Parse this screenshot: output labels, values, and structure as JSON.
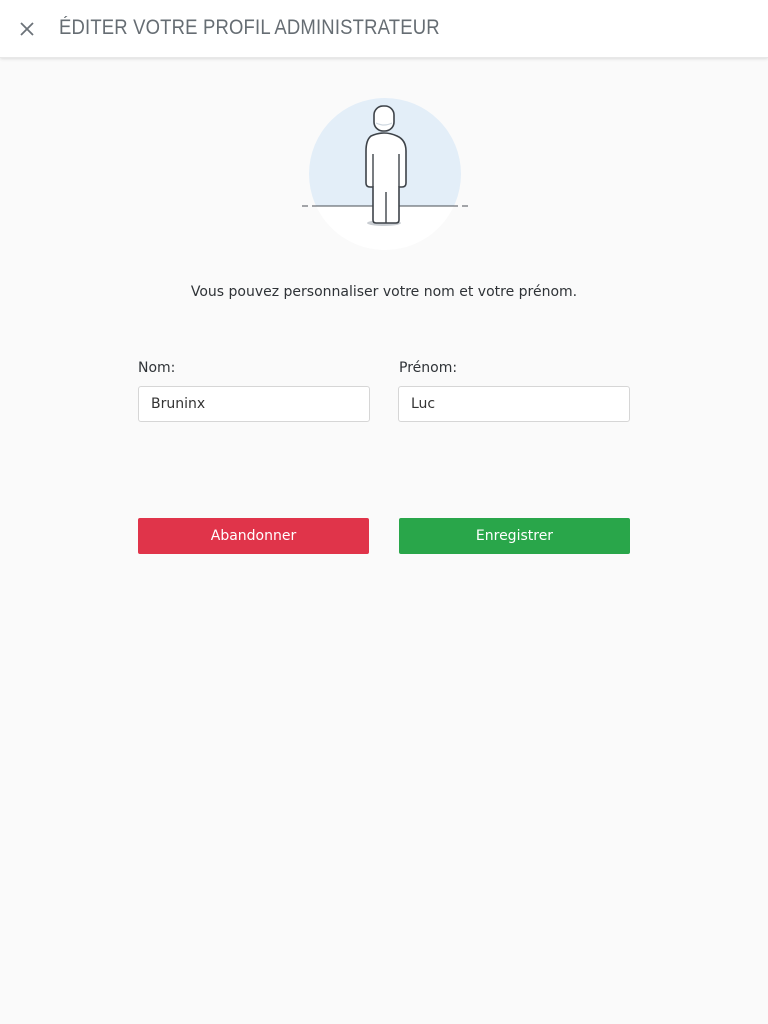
{
  "header": {
    "close_icon": "close-icon",
    "title": "ÉDITER VOTRE PROFIL ADMINISTRATEUR"
  },
  "illustration": {
    "icon": "person-standing-icon",
    "circle_color": "#e3eef8"
  },
  "intro_text": "Vous pouvez personnaliser votre nom et votre prénom.",
  "form": {
    "last_name": {
      "label": "Nom:",
      "value": "Bruninx"
    },
    "first_name": {
      "label": "Prénom:",
      "value": "Luc"
    }
  },
  "actions": {
    "cancel_label": "Abandonner",
    "save_label": "Enregistrer"
  },
  "colors": {
    "cancel": "#e0344a",
    "save": "#29a64a",
    "background": "#fafafa"
  }
}
